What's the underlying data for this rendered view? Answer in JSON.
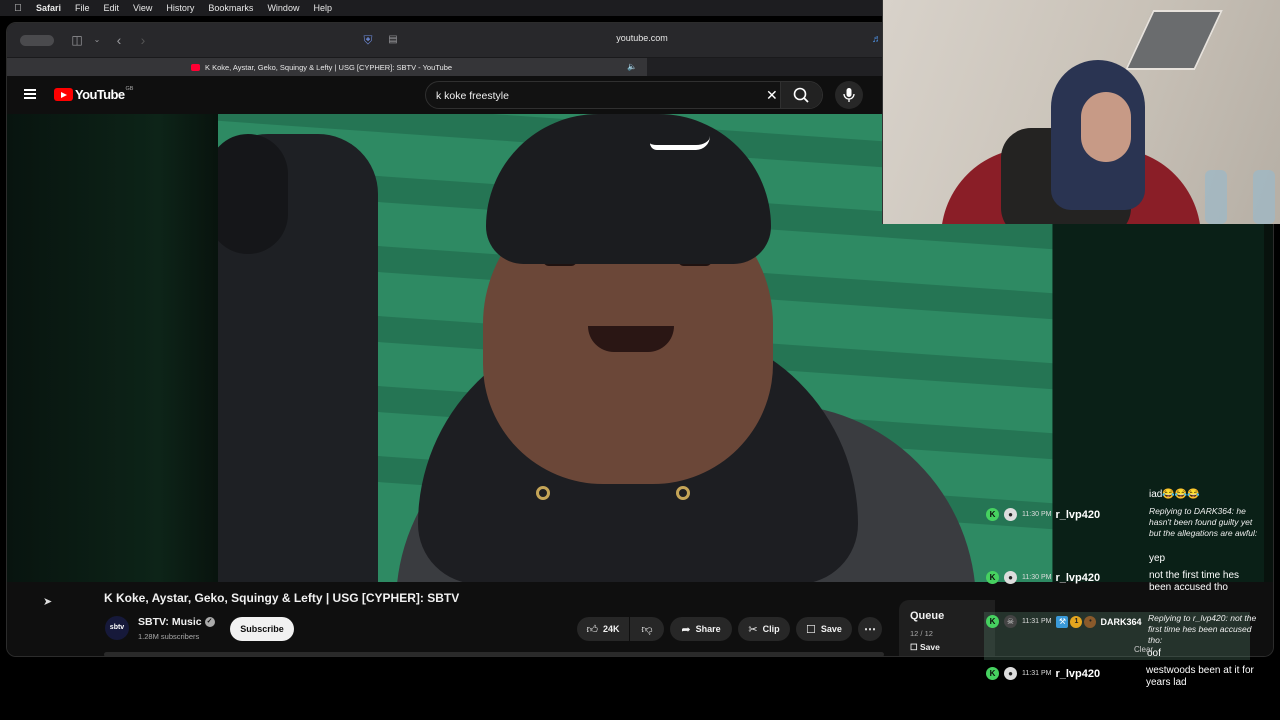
{
  "menubar": {
    "apple_icon": "apple-logo",
    "items": [
      "Safari",
      "File",
      "Edit",
      "View",
      "History",
      "Bookmarks",
      "Window",
      "Help"
    ]
  },
  "browser": {
    "url": "youtube.com",
    "tab_title": "K Koke, Aystar, Geko, Squingy & Lefty | USG [CYPHER]: SBTV - YouTube"
  },
  "youtube": {
    "logo_text": "YouTube",
    "region": "GB",
    "search_value": "k koke freestyle",
    "video_title": "K Koke, Aystar, Geko, Squingy & Lefty | USG [CYPHER]: SBTV",
    "channel": {
      "avatar_text": "sbtv",
      "name": "SBTV: Music",
      "subscribers": "1.28M subscribers",
      "subscribe_label": "Subscribe"
    },
    "actions": {
      "likes": "24K",
      "share": "Share",
      "clip": "Clip",
      "save": "Save"
    },
    "queue": {
      "title": "Queue",
      "count": "12 / 12",
      "save": "Save"
    }
  },
  "chat": {
    "messages": [
      {
        "text": "iad😂😂😂"
      },
      {
        "reply": "Replying to DARK364: he hasn't been found guilty yet but the allegations are awful:",
        "text": "yep",
        "time": "11:30 PM",
        "user": "r_lvp420"
      },
      {
        "text": "not the first time hes been accused tho",
        "time": "11:30 PM",
        "user": "r_lvp420"
      },
      {
        "reply": "Replying to r_lvp420: not the first time hes been accused tho:",
        "text": "oof",
        "time": "11:31 PM",
        "user": "DARK364",
        "badge_number": "1"
      },
      {
        "text": "westwoods been at it for years lad",
        "time": "11:31 PM",
        "user": "r_lvp420"
      }
    ],
    "clear_label": "Clear"
  },
  "colors": {
    "yt_red": "#ff0000",
    "chat_badge_green": "#46d160",
    "background": "#0f0f0f"
  }
}
